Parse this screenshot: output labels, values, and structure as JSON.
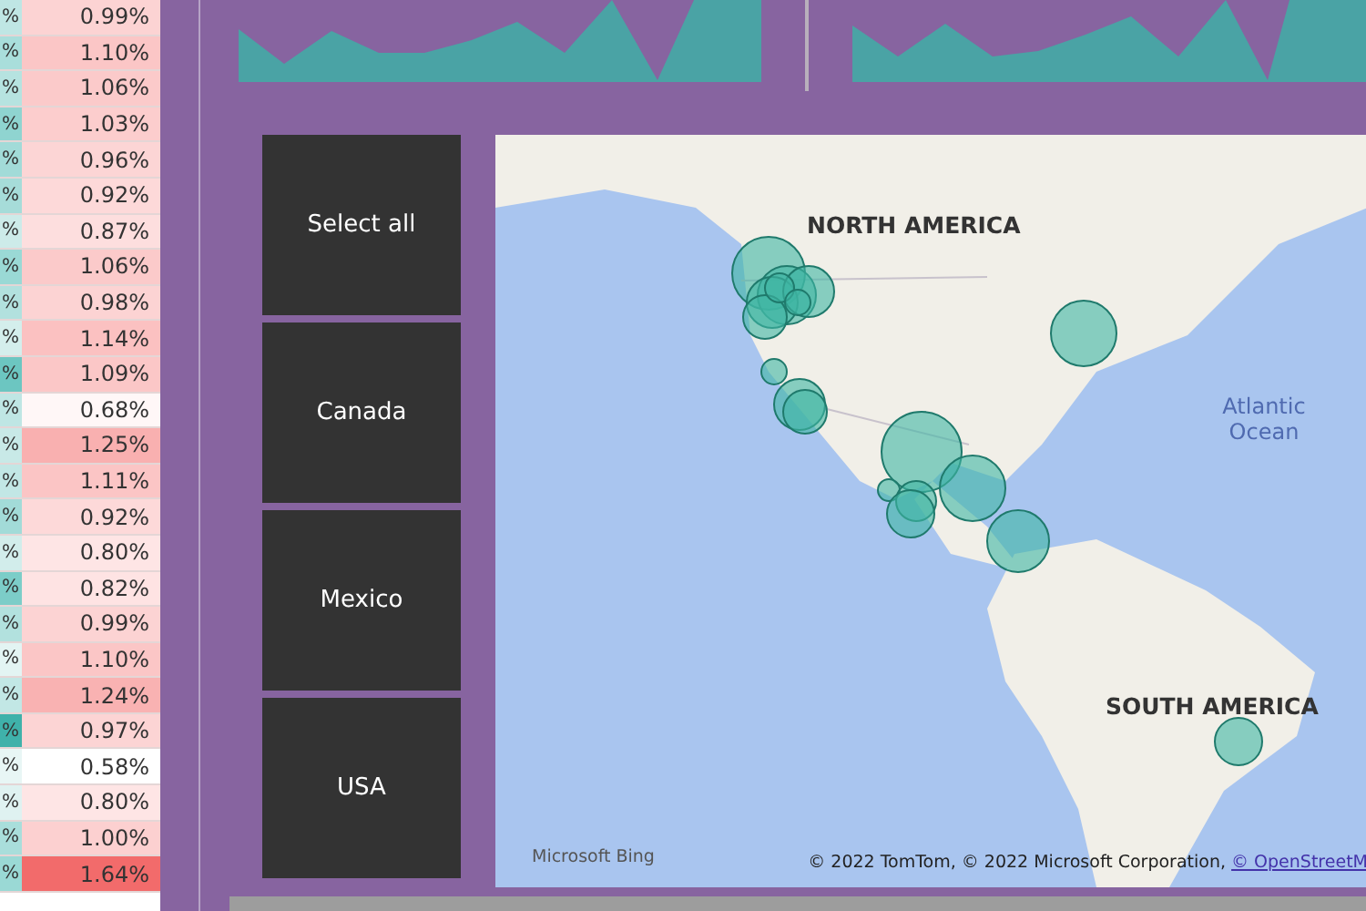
{
  "table": {
    "rows": [
      {
        "cells": [
          {
            "text": "%",
            "color": "#bfe6e4"
          },
          {
            "text": "0.99%",
            "color": "#fcd3d3"
          }
        ]
      },
      {
        "cells": [
          {
            "text": "%",
            "color": "#a9dedb"
          },
          {
            "text": "1.10%",
            "color": "#fbc6c6"
          }
        ]
      },
      {
        "cells": [
          {
            "text": "%",
            "color": "#b6e3e0"
          },
          {
            "text": "1.06%",
            "color": "#fbcaca"
          }
        ]
      },
      {
        "cells": [
          {
            "text": "%",
            "color": "#8fd4d0"
          },
          {
            "text": "1.03%",
            "color": "#fccdcd"
          }
        ]
      },
      {
        "cells": [
          {
            "text": "%",
            "color": "#a2dbd8"
          },
          {
            "text": "0.96%",
            "color": "#fcd5d5"
          }
        ]
      },
      {
        "cells": [
          {
            "text": "%",
            "color": "#a6dcd9"
          },
          {
            "text": "0.92%",
            "color": "#fdd9d9"
          }
        ]
      },
      {
        "cells": [
          {
            "text": "%",
            "color": "#cdebe9"
          },
          {
            "text": "0.87%",
            "color": "#fddede"
          }
        ]
      },
      {
        "cells": [
          {
            "text": "%",
            "color": "#9ad9d5"
          },
          {
            "text": "1.06%",
            "color": "#fbcaca"
          }
        ]
      },
      {
        "cells": [
          {
            "text": "%",
            "color": "#b2e1de"
          },
          {
            "text": "0.98%",
            "color": "#fcd3d3"
          }
        ]
      },
      {
        "cells": [
          {
            "text": "%",
            "color": "#d4eeec"
          },
          {
            "text": "1.14%",
            "color": "#fbc1c1"
          }
        ]
      },
      {
        "cells": [
          {
            "text": "%",
            "color": "#6cc6c1"
          },
          {
            "text": "1.09%",
            "color": "#fbc7c7"
          }
        ]
      },
      {
        "cells": [
          {
            "text": "%",
            "color": "#bfe6e4"
          },
          {
            "text": "0.68%",
            "color": "#fff7f7"
          }
        ]
      },
      {
        "cells": [
          {
            "text": "%",
            "color": "#c8e9e7"
          },
          {
            "text": "1.25%",
            "color": "#f9b0b0"
          }
        ]
      },
      {
        "cells": [
          {
            "text": "%",
            "color": "#c2e7e5"
          },
          {
            "text": "1.11%",
            "color": "#fbc5c5"
          }
        ]
      },
      {
        "cells": [
          {
            "text": "%",
            "color": "#a2dbd8"
          },
          {
            "text": "0.92%",
            "color": "#fdd9d9"
          }
        ]
      },
      {
        "cells": [
          {
            "text": "%",
            "color": "#d2edeb"
          },
          {
            "text": "0.80%",
            "color": "#fee5e5"
          }
        ]
      },
      {
        "cells": [
          {
            "text": "%",
            "color": "#7ccdc8"
          },
          {
            "text": "0.82%",
            "color": "#fee3e3"
          }
        ]
      },
      {
        "cells": [
          {
            "text": "%",
            "color": "#b2e1de"
          },
          {
            "text": "0.99%",
            "color": "#fcd3d3"
          }
        ]
      },
      {
        "cells": [
          {
            "text": "%",
            "color": "#e3f4f3"
          },
          {
            "text": "1.10%",
            "color": "#fbc6c6"
          }
        ]
      },
      {
        "cells": [
          {
            "text": "%",
            "color": "#c2e7e5"
          },
          {
            "text": "1.24%",
            "color": "#f9b2b2"
          }
        ]
      },
      {
        "cells": [
          {
            "text": "%",
            "color": "#3fb1aa"
          },
          {
            "text": "0.97%",
            "color": "#fcd4d4"
          }
        ]
      },
      {
        "cells": [
          {
            "text": "%",
            "color": "#e8f6f5"
          },
          {
            "text": "0.58%",
            "color": "#ffffff"
          }
        ]
      },
      {
        "cells": [
          {
            "text": "%",
            "color": "#dff2f1"
          },
          {
            "text": "0.80%",
            "color": "#fee5e5"
          }
        ]
      },
      {
        "cells": [
          {
            "text": "%",
            "color": "#a9dedb"
          },
          {
            "text": "1.00%",
            "color": "#fcd0d0"
          }
        ]
      },
      {
        "cells": [
          {
            "text": "%",
            "color": "#9ad9d5"
          },
          {
            "text": "1.64%",
            "color": "#f26b6b"
          }
        ]
      }
    ]
  },
  "slicer": {
    "items": [
      {
        "label": "Select all",
        "selected": false
      },
      {
        "label": "Canada",
        "selected": false
      },
      {
        "label": "Mexico",
        "selected": false
      },
      {
        "label": "USA",
        "selected": false
      }
    ]
  },
  "map": {
    "labels": [
      "NORTH AMERICA",
      "Atlantic Ocean",
      "SOUTH AMERICA"
    ],
    "logo": "Microsoft Bing",
    "copyright": "© 2022 TomTom, © 2022 Microsoft Corporation,",
    "copyright_link": "© OpenStreetM"
  }
}
